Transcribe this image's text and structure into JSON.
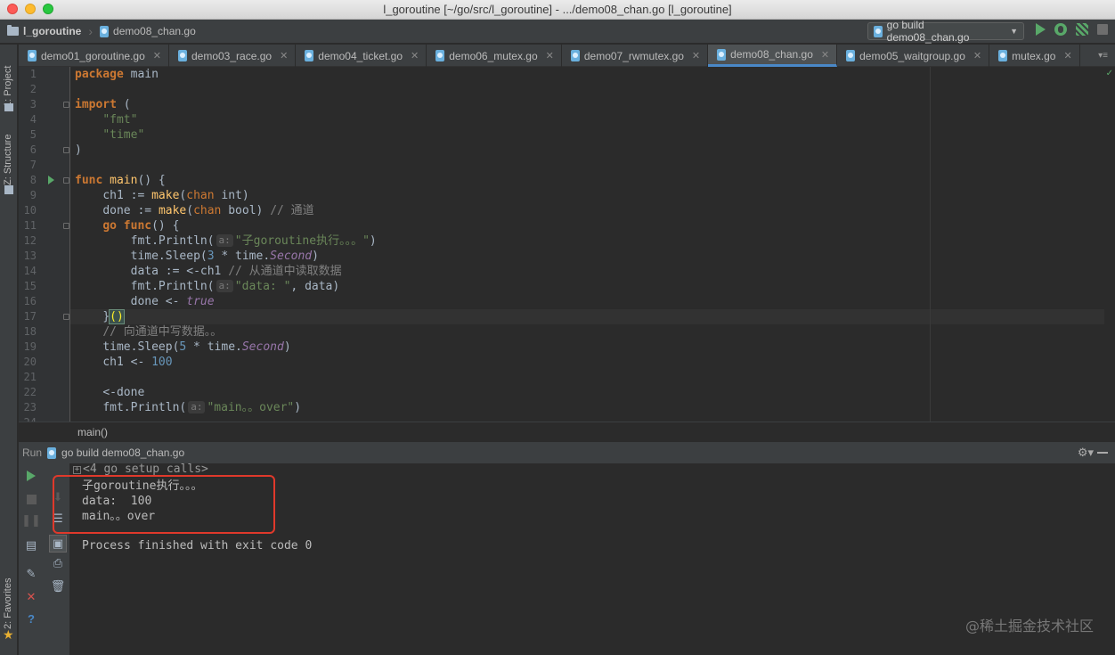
{
  "window": {
    "title": "l_goroutine [~/go/src/l_goroutine] - .../demo08_chan.go [l_goroutine]"
  },
  "navbar": {
    "project": "l_goroutine",
    "file": "demo08_chan.go",
    "run_config": "go build demo08_chan.go"
  },
  "left_strip": {
    "project": "1: Project",
    "structure": "Z: Structure",
    "favorites": "2: Favorites"
  },
  "tabs": [
    {
      "label": "demo01_goroutine.go",
      "active": false
    },
    {
      "label": "demo03_race.go",
      "active": false
    },
    {
      "label": "demo04_ticket.go",
      "active": false
    },
    {
      "label": "demo06_mutex.go",
      "active": false
    },
    {
      "label": "demo07_rwmutex.go",
      "active": false
    },
    {
      "label": "demo08_chan.go",
      "active": true
    },
    {
      "label": "demo05_waitgroup.go",
      "active": false
    },
    {
      "label": "mutex.go",
      "active": false
    }
  ],
  "editor": {
    "line_numbers": [
      "1",
      "2",
      "3",
      "4",
      "5",
      "6",
      "7",
      "8",
      "9",
      "10",
      "11",
      "12",
      "13",
      "14",
      "15",
      "16",
      "17",
      "18",
      "19",
      "20",
      "21",
      "22",
      "23",
      "24"
    ],
    "param_hint": "a:",
    "code": {
      "l1_kw": "package",
      "l1_rest": " main",
      "l3_kw": "import",
      "l3_rest": " (",
      "l4": "\"fmt\"",
      "l5": "\"time\"",
      "l6": ")",
      "l8_kw": "func",
      "l8_fn": " main",
      "l8_rest": "() {",
      "l9_a": "ch1 := ",
      "l9_make": "make",
      "l9_b": "(",
      "l9_chan": "chan",
      "l9_c": " int)",
      "l10_a": "done := ",
      "l10_make": "make",
      "l10_b": "(",
      "l10_chan": "chan",
      "l10_c": " bool) ",
      "l10_cmt": "// 通道",
      "l11_go": "go",
      "l11_func": " func",
      "l11_rest": "() {",
      "l12_a": "fmt.Println(",
      "l12_str": "\"子goroutine执行。。。\"",
      "l12_b": ")",
      "l13_a": "time.Sleep(",
      "l13_num": "3",
      "l13_b": " * time.",
      "l13_it": "Second",
      "l13_c": ")",
      "l14_a": "data := <-ch1 ",
      "l14_cmt": "// 从通道中读取数据",
      "l15_a": "fmt.Println(",
      "l15_str": "\"data: \"",
      "l15_b": ", data)",
      "l16_a": "done <- ",
      "l16_it": "true",
      "l17_a": "}",
      "l17_b": "()",
      "l18_cmt": "// 向通道中写数据。。",
      "l19_a": "time.Sleep(",
      "l19_num": "5",
      "l19_b": " * time.",
      "l19_it": "Second",
      "l19_c": ")",
      "l20_a": "ch1 <- ",
      "l20_num": "100",
      "l22": "<-done",
      "l23_a": "fmt.Println(",
      "l23_str": "\"main。。over\"",
      "l23_b": ")"
    },
    "breadcrumb": "main()"
  },
  "run_panel": {
    "label": "Run",
    "config": "go build demo08_chan.go",
    "setup_calls": "<4 go setup calls>",
    "output": [
      "子goroutine执行。。。",
      "data:  100",
      "main。。over"
    ],
    "exit_message": "Process finished with exit code 0"
  },
  "watermark": "@稀土掘金技术社区",
  "colors": {
    "accent": "#4a88c7",
    "run_green": "#59a869",
    "highlight_box": "#e0392b"
  }
}
